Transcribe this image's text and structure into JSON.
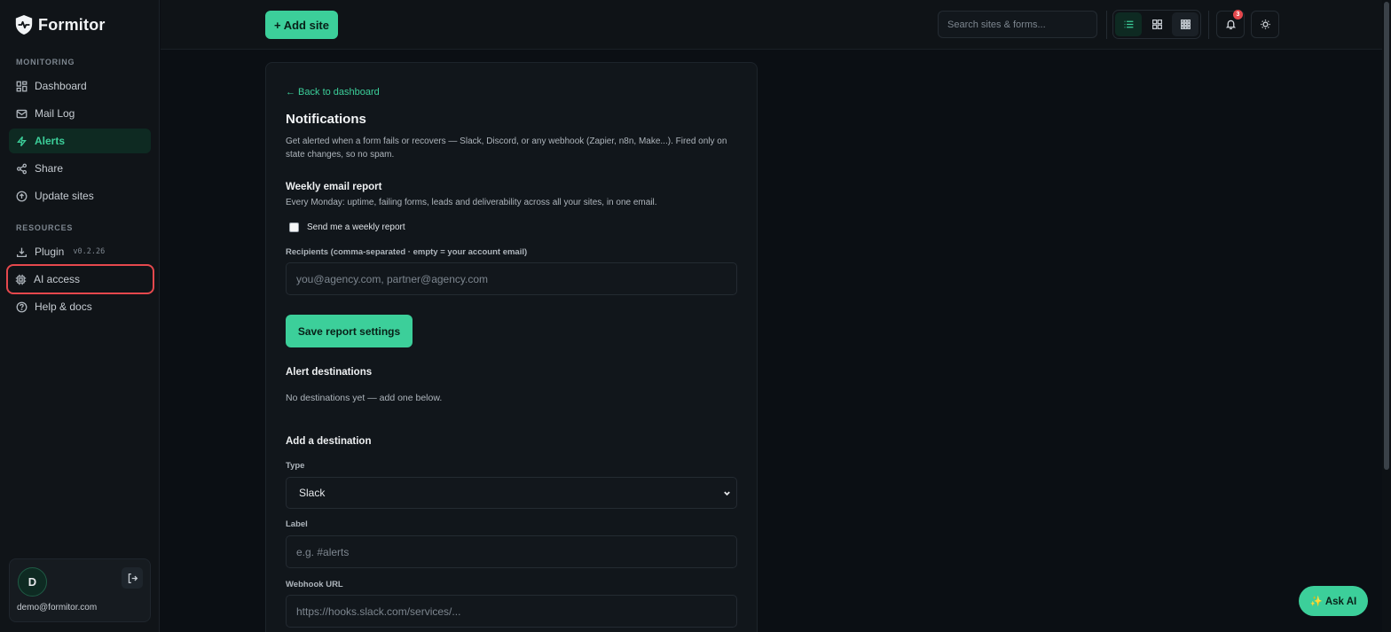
{
  "brand": {
    "name": "Formitor"
  },
  "sidebar": {
    "monitoring_label": "MONITORING",
    "resources_label": "RESOURCES",
    "items": [
      {
        "label": "Dashboard",
        "icon": "dashboard-icon"
      },
      {
        "label": "Mail Log",
        "icon": "mail-icon"
      },
      {
        "label": "Alerts",
        "icon": "bolt-icon",
        "active": true
      },
      {
        "label": "Share",
        "icon": "share-icon"
      },
      {
        "label": "Update sites",
        "icon": "upload-icon"
      },
      {
        "label": "Plugin",
        "icon": "download-icon",
        "badge": "v0.2.26"
      },
      {
        "label": "AI access",
        "icon": "chip-icon",
        "highlighted": true
      },
      {
        "label": "Help & docs",
        "icon": "help-icon"
      }
    ],
    "user": {
      "initial": "D",
      "email": "demo@formitor.com"
    }
  },
  "topbar": {
    "add_site_label": "+ Add site",
    "search_placeholder": "Search sites & forms...",
    "notification_count": "3"
  },
  "page": {
    "back_link": "← Back to dashboard",
    "title": "Notifications",
    "description": "Get alerted when a form fails or recovers — Slack, Discord, or any webhook (Zapier, n8n, Make...). Fired only on state changes, so no spam.",
    "weekly": {
      "title": "Weekly email report",
      "description": "Every Monday: uptime, failing forms, leads and deliverability across all your sites, in one email.",
      "checkbox_label": "Send me a weekly report",
      "checked": false,
      "recipients_label": "Recipients (comma-separated · empty = your account email)",
      "recipients_placeholder": "you@agency.com, partner@agency.com",
      "save_label": "Save report settings"
    },
    "destinations": {
      "title": "Alert destinations",
      "empty_text": "No destinations yet — add one below."
    },
    "add_destination": {
      "title": "Add a destination",
      "type_label": "Type",
      "type_value": "Slack",
      "label_label": "Label",
      "label_placeholder": "e.g. #alerts",
      "webhook_label": "Webhook URL",
      "webhook_placeholder": "https://hooks.slack.com/services/..."
    }
  },
  "ask_ai_label": "✨ Ask AI",
  "colors": {
    "accent": "#3ccf9a",
    "background": "#0b0f14",
    "danger": "#e5484d"
  }
}
